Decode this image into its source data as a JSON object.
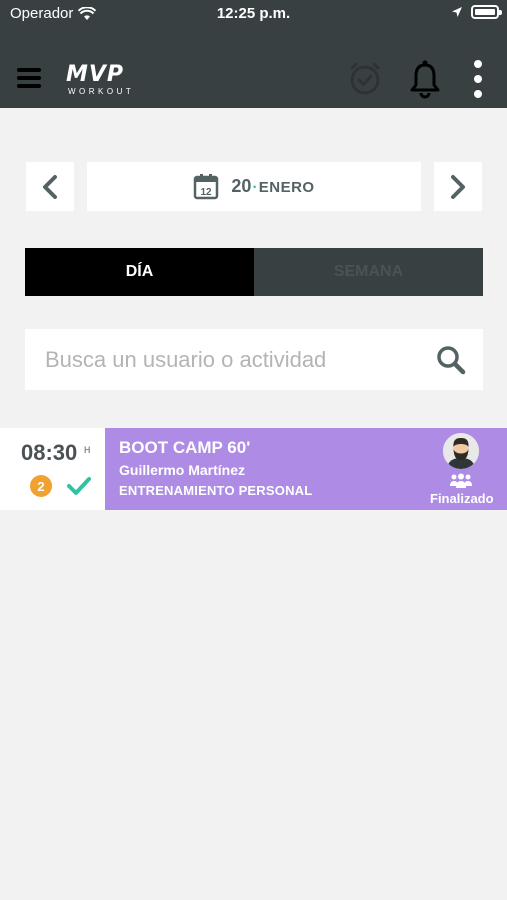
{
  "status_bar": {
    "carrier": "Operador",
    "time": "12:25 p.m."
  },
  "header": {
    "logo_main": "MVP",
    "logo_sub": "WORKOUT",
    "icons": [
      "menu-icon",
      "alarm-clock-icon",
      "bell-icon",
      "more-vertical-icon"
    ]
  },
  "date_nav": {
    "calendar_day": "12",
    "day": "20",
    "separator": "·",
    "month": "ENERO"
  },
  "tabs": [
    {
      "label": "DÍA",
      "active": true
    },
    {
      "label": "SEMANA",
      "active": false
    }
  ],
  "search": {
    "placeholder": "Busca un usuario o actividad"
  },
  "activities": [
    {
      "time": "08:30",
      "time_unit": "H",
      "count": "2",
      "title": "BOOT CAMP 60'",
      "trainer": "Guillermo Martínez",
      "type": "ENTRENAMIENTO PERSONAL",
      "status": "Finalizado",
      "color": "#ae8ce5"
    }
  ],
  "colors": {
    "header_bg": "#384042",
    "accent_green": "#2ec4a2",
    "badge_orange": "#f0a12f",
    "card_purple": "#ae8ce5"
  }
}
